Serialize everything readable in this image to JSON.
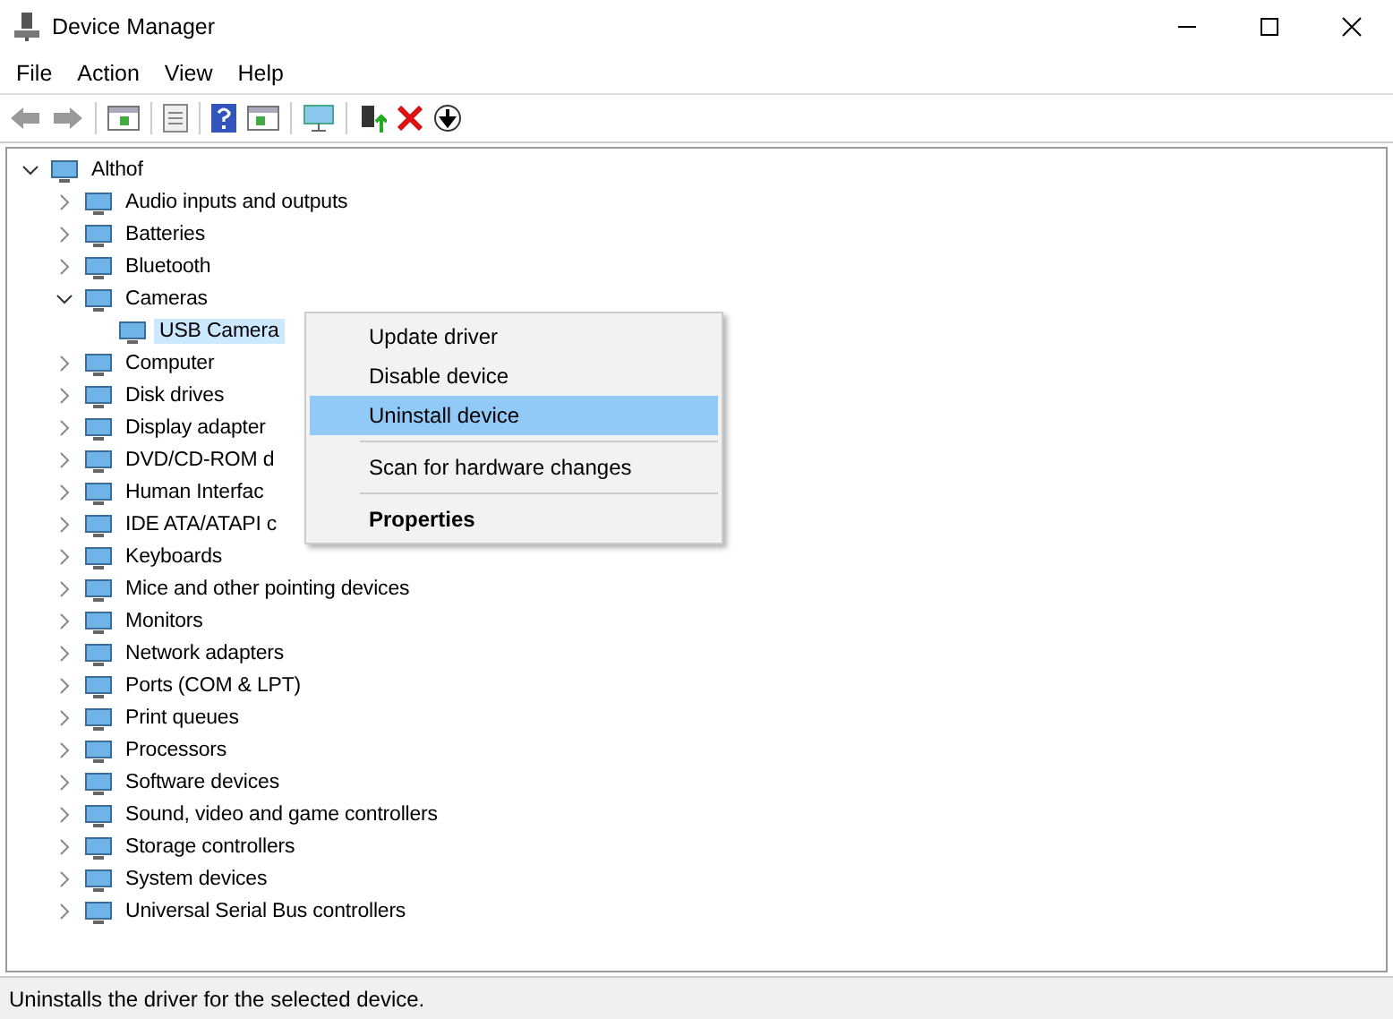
{
  "window": {
    "title": "Device Manager"
  },
  "menu": [
    "File",
    "Action",
    "View",
    "Help"
  ],
  "tree": {
    "label": "Althof",
    "expanded": true,
    "children": [
      {
        "label": "Audio inputs and outputs",
        "expanded": false
      },
      {
        "label": "Batteries",
        "expanded": false
      },
      {
        "label": "Bluetooth",
        "expanded": false
      },
      {
        "label": "Cameras",
        "expanded": true,
        "children": [
          {
            "label": "USB Camera",
            "selected": true
          }
        ]
      },
      {
        "label": "Computer",
        "expanded": false
      },
      {
        "label": "Disk drives",
        "expanded": false
      },
      {
        "label": "Display adapter",
        "expanded": false
      },
      {
        "label": "DVD/CD-ROM d",
        "expanded": false
      },
      {
        "label": "Human Interfac",
        "expanded": false
      },
      {
        "label": "IDE ATA/ATAPI c",
        "expanded": false
      },
      {
        "label": "Keyboards",
        "expanded": false
      },
      {
        "label": "Mice and other pointing devices",
        "expanded": false
      },
      {
        "label": "Monitors",
        "expanded": false
      },
      {
        "label": "Network adapters",
        "expanded": false
      },
      {
        "label": "Ports (COM & LPT)",
        "expanded": false
      },
      {
        "label": "Print queues",
        "expanded": false
      },
      {
        "label": "Processors",
        "expanded": false
      },
      {
        "label": "Software devices",
        "expanded": false
      },
      {
        "label": "Sound, video and game controllers",
        "expanded": false
      },
      {
        "label": "Storage controllers",
        "expanded": false
      },
      {
        "label": "System devices",
        "expanded": false
      },
      {
        "label": "Universal Serial Bus controllers",
        "expanded": false
      }
    ]
  },
  "context_menu": [
    {
      "kind": "item",
      "label": "Update driver",
      "selected": false
    },
    {
      "kind": "item",
      "label": "Disable device",
      "selected": false
    },
    {
      "kind": "item",
      "label": "Uninstall device",
      "selected": true
    },
    {
      "kind": "separator"
    },
    {
      "kind": "item",
      "label": "Scan for hardware changes",
      "selected": false
    },
    {
      "kind": "separator"
    },
    {
      "kind": "default",
      "label": "Properties",
      "selected": false
    }
  ],
  "status_bar": "Uninstalls the driver for the selected device."
}
